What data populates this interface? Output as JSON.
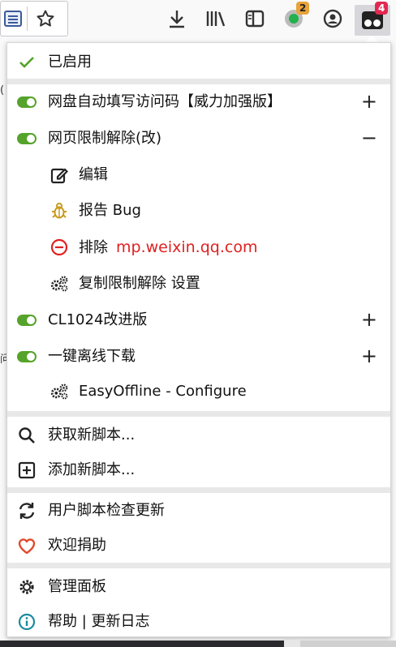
{
  "toolbar": {
    "greasy_badge": "2",
    "tm_badge": "4"
  },
  "menu": {
    "enabled_label": "已启用",
    "scripts": [
      {
        "label": "网盘自动填写访问码【威力加强版】",
        "action": "+"
      },
      {
        "label": "网页限制解除(改)",
        "action": "−"
      },
      {
        "label": "CL1024改进版",
        "action": "+"
      },
      {
        "label": "一键离线下载",
        "action": "+"
      }
    ],
    "sub": {
      "edit": "编辑",
      "report": "报告 Bug",
      "exclude": "排除",
      "exclude_domain": "mp.weixin.qq.com",
      "copy_settings": "复制限制解除 设置",
      "easyoffline": "EasyOffline - Configure"
    },
    "get_new": "获取新脚本...",
    "add_new": "添加新脚本...",
    "check_updates": "用户脚本检查更新",
    "donate": "欢迎捐助",
    "dashboard": "管理面板",
    "help": "帮助 | 更新日志"
  },
  "colors": {
    "toggle_on": "#55a32a",
    "badge_orange": "#e8a33b",
    "badge_red": "#e22850",
    "domain_red": "#e02020",
    "heart_red": "#e2472b",
    "info_teal": "#1a8ca0"
  }
}
